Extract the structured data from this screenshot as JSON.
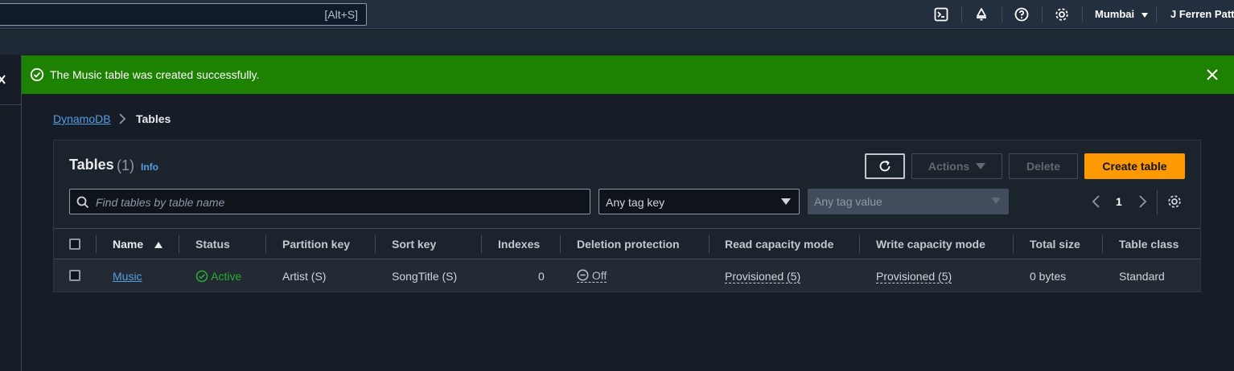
{
  "topnav": {
    "search_shortcut": "[Alt+S]",
    "region": "Mumbai",
    "user": "J Ferren Patto"
  },
  "flash": {
    "message": "The Music table was created successfully."
  },
  "breadcrumb": {
    "root": "DynamoDB",
    "current": "Tables"
  },
  "panel": {
    "title": "Tables",
    "count": "(1)",
    "info": "Info",
    "actions_label": "Actions",
    "delete_label": "Delete",
    "create_label": "Create table"
  },
  "filters": {
    "search_placeholder": "Find tables by table name",
    "tag_key": "Any tag key",
    "tag_value": "Any tag value"
  },
  "pagination": {
    "current_page": "1"
  },
  "table": {
    "columns": [
      "Name",
      "Status",
      "Partition key",
      "Sort key",
      "Indexes",
      "Deletion protection",
      "Read capacity mode",
      "Write capacity mode",
      "Total size",
      "Table class"
    ],
    "rows": [
      {
        "name": "Music",
        "status": "Active",
        "partition_key": "Artist (S)",
        "sort_key": "SongTitle (S)",
        "indexes": "0",
        "deletion_protection": "Off",
        "read_capacity": "Provisioned (5)",
        "write_capacity": "Provisioned (5)",
        "total_size": "0 bytes",
        "table_class": "Standard"
      }
    ]
  },
  "colors": {
    "success": "#1d8102",
    "primary": "#ff9900",
    "link": "#539fe5",
    "status_active": "#29ad32"
  }
}
